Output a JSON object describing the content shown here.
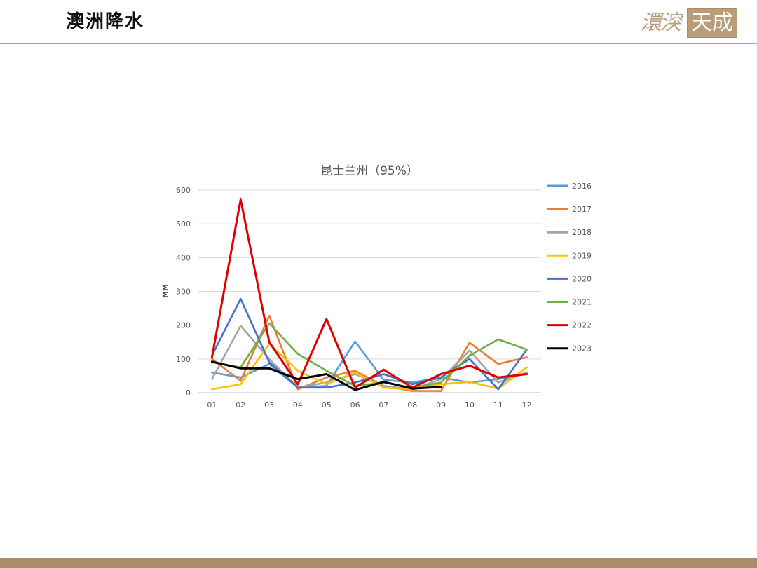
{
  "header": {
    "title": "澳洲降水",
    "logo_left": "澴湥",
    "logo_right": "天成"
  },
  "colors": {
    "accent": "#b99d7a",
    "rule": "#b7a48b",
    "footer": "#a88d6a"
  },
  "chart_data": {
    "type": "line",
    "title": "昆士兰州（95%）",
    "xlabel": "",
    "ylabel": "MM",
    "ylim": [
      0,
      600
    ],
    "yticks": [
      0,
      100,
      200,
      300,
      400,
      500,
      600
    ],
    "grid": true,
    "legend_position": "right",
    "categories": [
      "01",
      "02",
      "03",
      "04",
      "05",
      "06",
      "07",
      "08",
      "09",
      "10",
      "11",
      "12"
    ],
    "series": [
      {
        "name": "2016",
        "color": "#5b9bd5",
        "values": [
          60,
          45,
          85,
          15,
          20,
          152,
          38,
          30,
          45,
          30,
          40,
          58
        ]
      },
      {
        "name": "2017",
        "color": "#ed7d31",
        "values": [
          100,
          35,
          228,
          10,
          45,
          65,
          20,
          5,
          5,
          148,
          85,
          105
        ]
      },
      {
        "name": "2018",
        "color": "#a5a5a5",
        "values": [
          40,
          198,
          100,
          15,
          30,
          55,
          20,
          10,
          40,
          125,
          30,
          60
        ]
      },
      {
        "name": "2019",
        "color": "#ffc000",
        "values": [
          10,
          25,
          145,
          65,
          25,
          60,
          15,
          10,
          25,
          32,
          12,
          75
        ]
      },
      {
        "name": "2020",
        "color": "#4472c4",
        "values": [
          110,
          278,
          90,
          15,
          15,
          30,
          55,
          25,
          45,
          100,
          10,
          128
        ]
      },
      {
        "name": "2021",
        "color": "#70ad47",
        "values": [
          90,
          75,
          205,
          115,
          65,
          20,
          30,
          15,
          30,
          110,
          158,
          128
        ]
      },
      {
        "name": "2022",
        "color": "#e00000",
        "values": [
          105,
          572,
          150,
          25,
          218,
          15,
          68,
          15,
          55,
          80,
          45,
          55
        ]
      },
      {
        "name": "2023",
        "color": "#000000",
        "values": [
          92,
          72,
          72,
          40,
          55,
          8,
          32,
          12,
          17,
          null,
          null,
          null
        ]
      }
    ]
  }
}
